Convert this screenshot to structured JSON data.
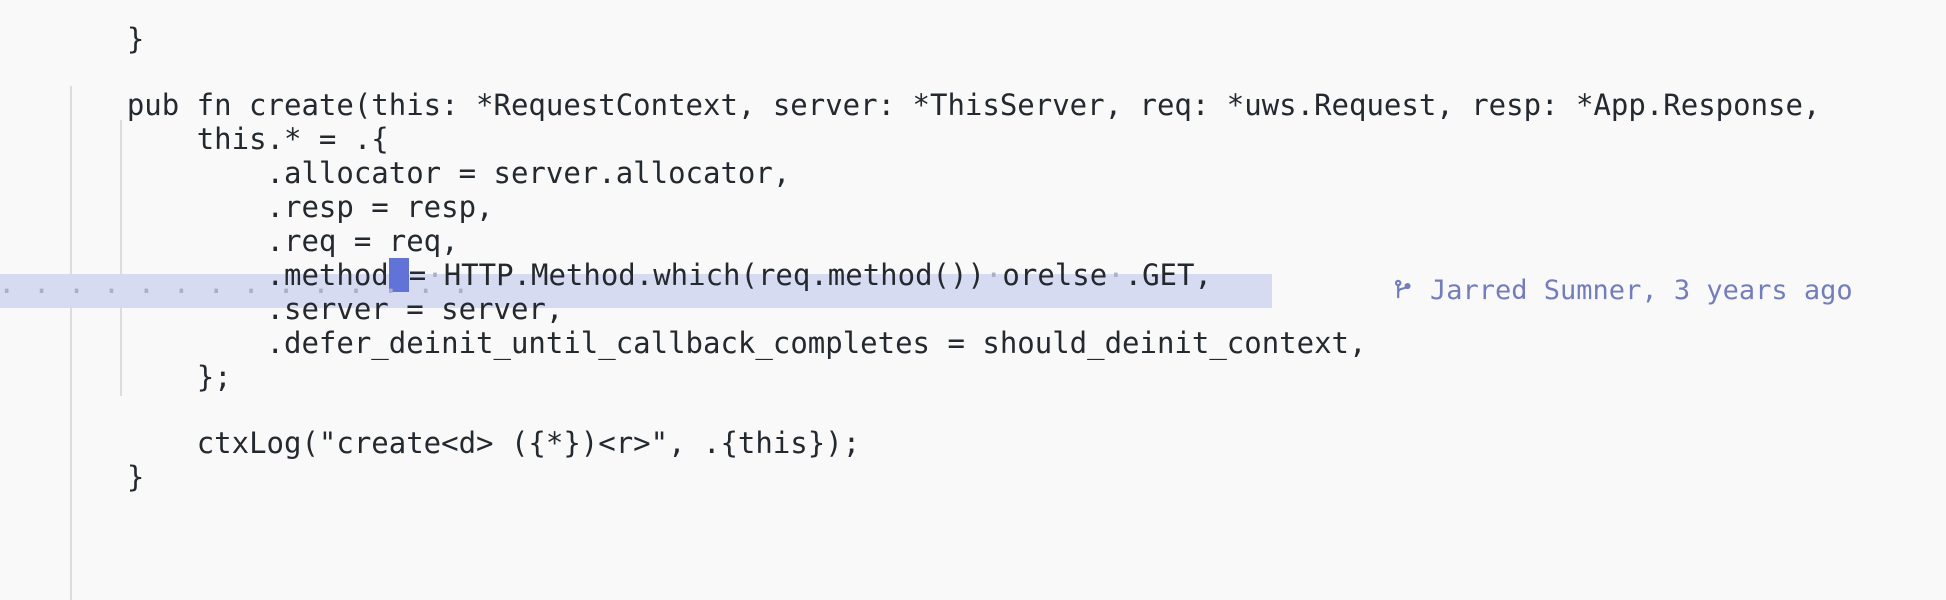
{
  "editor": {
    "background_color": "#f9f9f9",
    "text_color": "#24292f",
    "active_line_background": "#d7dbf2",
    "cursor_color": "#6173d6",
    "indent_guide_color": "#dcdcdc",
    "whitespace_dot_color": "#a9aec9",
    "language": "zig"
  },
  "code": {
    "lines": [
      {
        "indent": "",
        "text": "}"
      },
      {
        "indent": "",
        "text": ""
      },
      {
        "indent": "",
        "text": "pub fn create(this: *RequestContext, server: *ThisServer, req: *uws.Request, resp: *App.Response,"
      },
      {
        "indent": "    ",
        "text": "this.* = .{"
      },
      {
        "indent": "        ",
        "text": ".allocator = server.allocator,"
      },
      {
        "indent": "        ",
        "text": ".resp = resp,"
      },
      {
        "indent": "        ",
        "text": ".req = req,"
      },
      {
        "indent": "        ",
        "text": ".method = HTTP.Method.which(req.method()) orelse .GET,"
      },
      {
        "indent": "        ",
        "text": ".server = server,"
      },
      {
        "indent": "        ",
        "text": ".defer_deinit_until_callback_completes = should_deinit_context,"
      },
      {
        "indent": "    ",
        "text": "};"
      },
      {
        "indent": "",
        "text": ""
      },
      {
        "indent": "    ",
        "text": "ctxLog(\"create<d> ({*})<r>\", .{this});"
      },
      {
        "indent": "",
        "text": "}"
      }
    ],
    "active_line_index": 7,
    "active_line_segments": [
      {
        "kind": "code",
        "value": ".method"
      },
      {
        "kind": "cursor",
        "value": " "
      },
      {
        "kind": "code",
        "value": "="
      },
      {
        "kind": "space",
        "value": "·"
      },
      {
        "kind": "code",
        "value": "HTTP.Method.which(req.method())"
      },
      {
        "kind": "space",
        "value": "·"
      },
      {
        "kind": "code",
        "value": "orelse"
      },
      {
        "kind": "space",
        "value": "·"
      },
      {
        "kind": "code",
        "value": ".GET,"
      }
    ],
    "active_line_leading_whitespace": "· · · · · · · · · · · · · ·"
  },
  "blame": {
    "icon": "git-branch-icon",
    "author": "Jarred Sumner",
    "relative_time": "3 years ago",
    "text": "Jarred Sumner, 3 years ago",
    "color": "#737dbb"
  }
}
